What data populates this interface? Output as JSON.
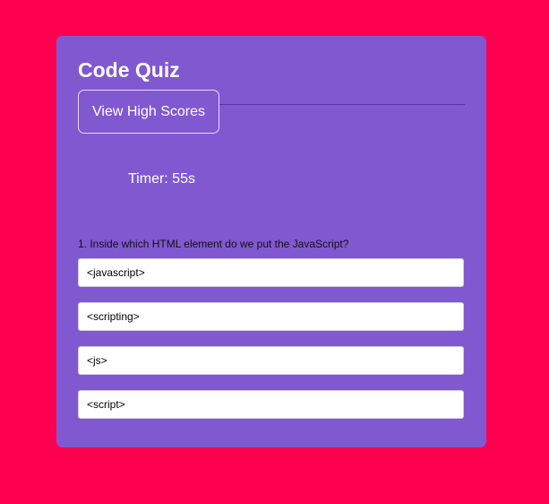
{
  "app": {
    "title": "Code Quiz",
    "high_scores_label": "View High Scores"
  },
  "timer": {
    "text": "Timer: 55s"
  },
  "quiz": {
    "question": "1. Inside which HTML element do we put the JavaScript?",
    "answers": [
      "<javascript>",
      "<scripting>",
      "<js>",
      "<script>"
    ]
  },
  "colors": {
    "page_background": "#ff0050",
    "card_background": "#8058d0",
    "card_text": "#ffffff",
    "answer_background": "#ffffff"
  }
}
